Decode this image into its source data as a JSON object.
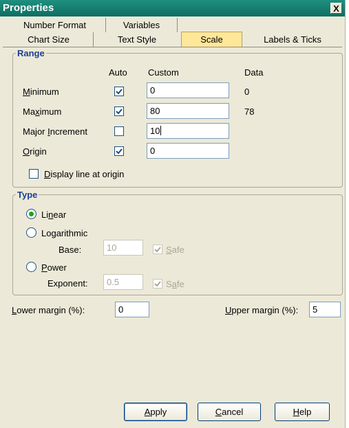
{
  "window": {
    "title": "Properties",
    "close_label": "X"
  },
  "tabs": {
    "row1": [
      "Number Format",
      "Variables"
    ],
    "row2": [
      "Chart Size",
      "Text Style",
      "Scale",
      "Labels & Ticks"
    ],
    "active": "Scale"
  },
  "range": {
    "legend": "Range",
    "col_auto": "Auto",
    "col_custom": "Custom",
    "col_data": "Data",
    "rows": [
      {
        "label_pre": "",
        "label_key": "M",
        "label_post": "inimum",
        "auto": true,
        "custom": "0",
        "data": "0"
      },
      {
        "label_pre": "Ma",
        "label_key": "x",
        "label_post": "imum",
        "auto": true,
        "custom": "80",
        "data": "78"
      },
      {
        "label_pre": "Major ",
        "label_key": "I",
        "label_post": "ncrement",
        "auto": false,
        "custom": "10",
        "data": ""
      },
      {
        "label_pre": "",
        "label_key": "O",
        "label_post": "rigin",
        "auto": true,
        "custom": "0",
        "data": ""
      }
    ],
    "display_line": {
      "key": "D",
      "rest": "isplay line at origin",
      "checked": false
    }
  },
  "type": {
    "legend": "Type",
    "linear": {
      "pre": "Li",
      "key": "n",
      "post": "ear",
      "selected": true
    },
    "log": {
      "pre": "Lo",
      "key": "g",
      "post": "arithmic",
      "selected": false
    },
    "base_label": "Base:",
    "base_value": "10",
    "safe_key": "S",
    "safe_rest": "afe",
    "safe2_pre": "S",
    "safe2_key": "a",
    "safe2_rest": "fe",
    "power": {
      "pre": "",
      "key": "P",
      "post": "ower",
      "selected": false
    },
    "exponent_label": "Exponent:",
    "exponent_value": "0.5"
  },
  "margins": {
    "lower_key": "L",
    "lower_rest": "ower margin (%):",
    "lower_value": "0",
    "upper_key": "U",
    "upper_rest": "pper margin (%):",
    "upper_value": "5"
  },
  "buttons": {
    "apply_key": "A",
    "apply_rest": "pply",
    "cancel_key": "C",
    "cancel_rest": "ancel",
    "help_key": "H",
    "help_rest": "elp"
  },
  "colors": {
    "titlebar": "#0e6e62",
    "legend": "#1d3f93",
    "active_tab": "#ffe79a",
    "radio_dot": "#21a121"
  }
}
